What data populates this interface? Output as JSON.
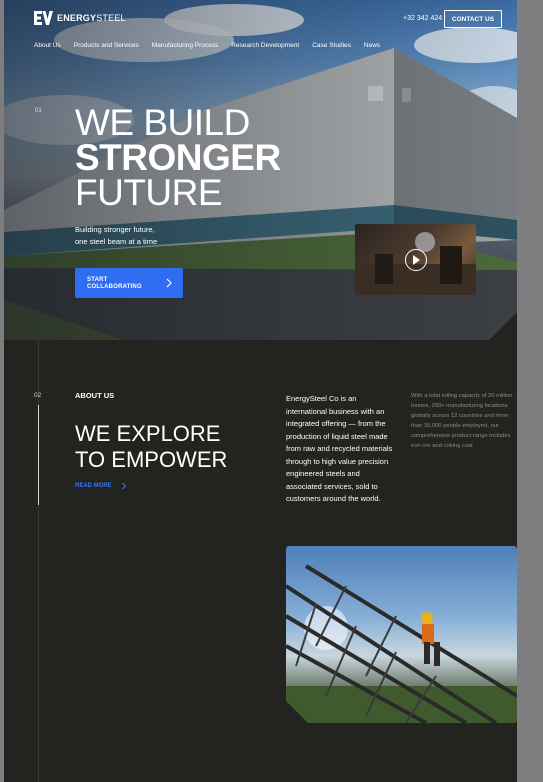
{
  "brand": {
    "name_bold": "ENERGY",
    "name_light": "STEEL"
  },
  "header": {
    "phone": "+32 342 424",
    "contact_label": "CONTACT US"
  },
  "nav": {
    "items": [
      "About Us",
      "Products and Services",
      "Manufacturing Process",
      "Research Development",
      "Case Studies",
      "News"
    ]
  },
  "hero": {
    "index": "01",
    "title_line1": "WE BUILD",
    "title_line2": "STRONGER",
    "title_line3": "FUTURE",
    "subtitle_line1": "Building stronger future,",
    "subtitle_line2": "one steel beam at a time",
    "cta_line1": "START",
    "cta_line2": "COLLABORATING",
    "video_icon": "play-icon"
  },
  "about": {
    "index": "02",
    "label": "ABOUT US",
    "title_line1": "WE EXPLORE",
    "title_line2": "TO EMPOWER",
    "read_more": "READ MORE",
    "paragraph": "EnergySteel Co is an international business with an integrated offering — from the production of liquid steel made from raw and recycled materials through to high value precision engineered steels and associated services, sold to customers around the world.",
    "side_note": "With a total rolling capacity of 20 million tonnes, 200+ manufacturing locations globally across 12 countries and more than 30,000 people employed, our comprehensive product range includes iron ore and coking coal"
  },
  "colors": {
    "accent": "#2f6ef2",
    "background": "#23231f",
    "muted_text": "#8d8d87"
  }
}
